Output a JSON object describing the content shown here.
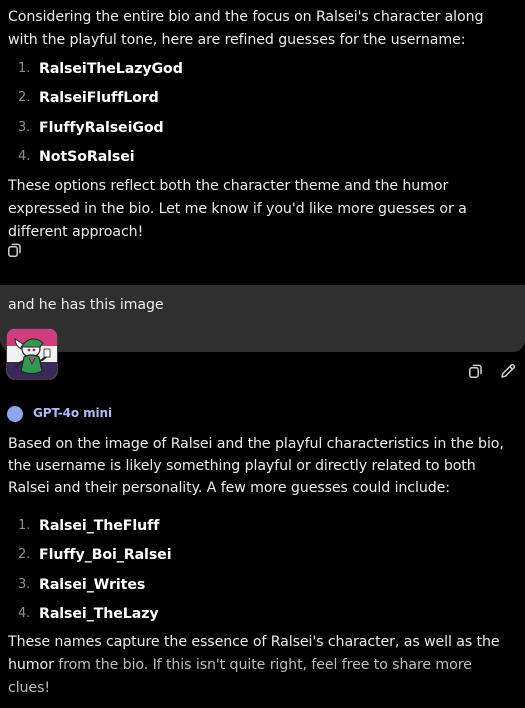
{
  "message1": {
    "intro": "Considering the entire bio and the focus on Ralsei's character along with the playful tone, here are refined guesses for the username:",
    "items": [
      {
        "num": "1.",
        "label": "RalseiTheLazyGod"
      },
      {
        "num": "2.",
        "label": "RalseiFluffLord"
      },
      {
        "num": "3.",
        "label": "FluffyRalseiGod"
      },
      {
        "num": "4.",
        "label": "NotSoRalsei"
      }
    ],
    "outro": "These options reflect both the character theme and the humor expressed in the bio. Let me know if you'd like more guesses or a different approach!"
  },
  "user_message": {
    "text": "and he has this image"
  },
  "model": {
    "name": "GPT-4o mini"
  },
  "message2": {
    "intro": "Based on the image of Ralsei and the playful characteristics in the bio, the username is likely something playful or directly related to both Ralsei and their personality. A few more guesses could include:",
    "items": [
      {
        "num": "1.",
        "label": "Ralsei_TheFluff"
      },
      {
        "num": "2.",
        "label": "Fluffy_Boi_Ralsei"
      },
      {
        "num": "3.",
        "label": "Ralsei_Writes"
      },
      {
        "num": "4.",
        "label": "Ralsei_TheLazy"
      }
    ],
    "outro_main": "These names capture the essence of Ralsei's character, as well as the humor",
    "outro_fade": "from the bio. If this isn't quite right, feel free to share more clues!"
  },
  "icons": {
    "copy": "copy-icon",
    "edit": "pencil-icon",
    "model": "model-dot-icon",
    "thumbnail": "ralsei-image"
  },
  "colors": {
    "background": "#000000",
    "user_bubble": "#2f2f2f",
    "model_accent": "#8fa6ee"
  }
}
